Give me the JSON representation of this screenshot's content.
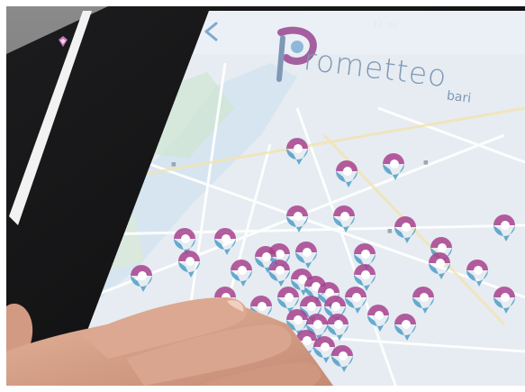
{
  "status_bar": {
    "time": "17:06"
  },
  "app": {
    "title": "rometteo",
    "subtitle": "bari"
  },
  "icons": {
    "back": "chevron-left-icon",
    "logo": "prometteo-logo-icon",
    "badge": "app-badge-icon",
    "pin": "map-pin-icon"
  },
  "colors": {
    "accent": "#8a5a9c",
    "pin_top": "#a7428e",
    "pin_bottom": "#4f9ec8",
    "logo_text": "#7e98b6",
    "map_base": "#e9eef3",
    "road": "#ffffff",
    "water": "#cfe1ef"
  },
  "map": {
    "pin_count": 40
  }
}
